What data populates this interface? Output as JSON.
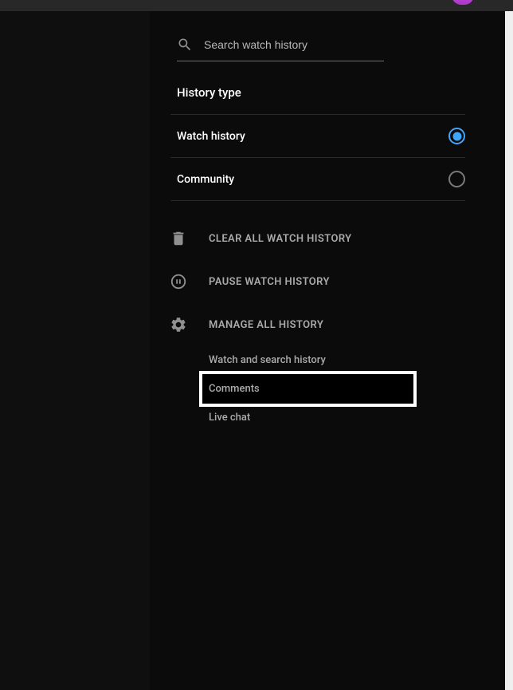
{
  "search": {
    "placeholder": "Search watch history"
  },
  "section_title": "History type",
  "history_types": [
    {
      "label": "Watch history",
      "selected": true
    },
    {
      "label": "Community",
      "selected": false
    }
  ],
  "actions": {
    "clear": "CLEAR ALL WATCH HISTORY",
    "pause": "PAUSE WATCH HISTORY",
    "manage": "MANAGE ALL HISTORY"
  },
  "sublinks": {
    "watch_search": "Watch and search history",
    "comments": "Comments",
    "live_chat": "Live chat"
  }
}
